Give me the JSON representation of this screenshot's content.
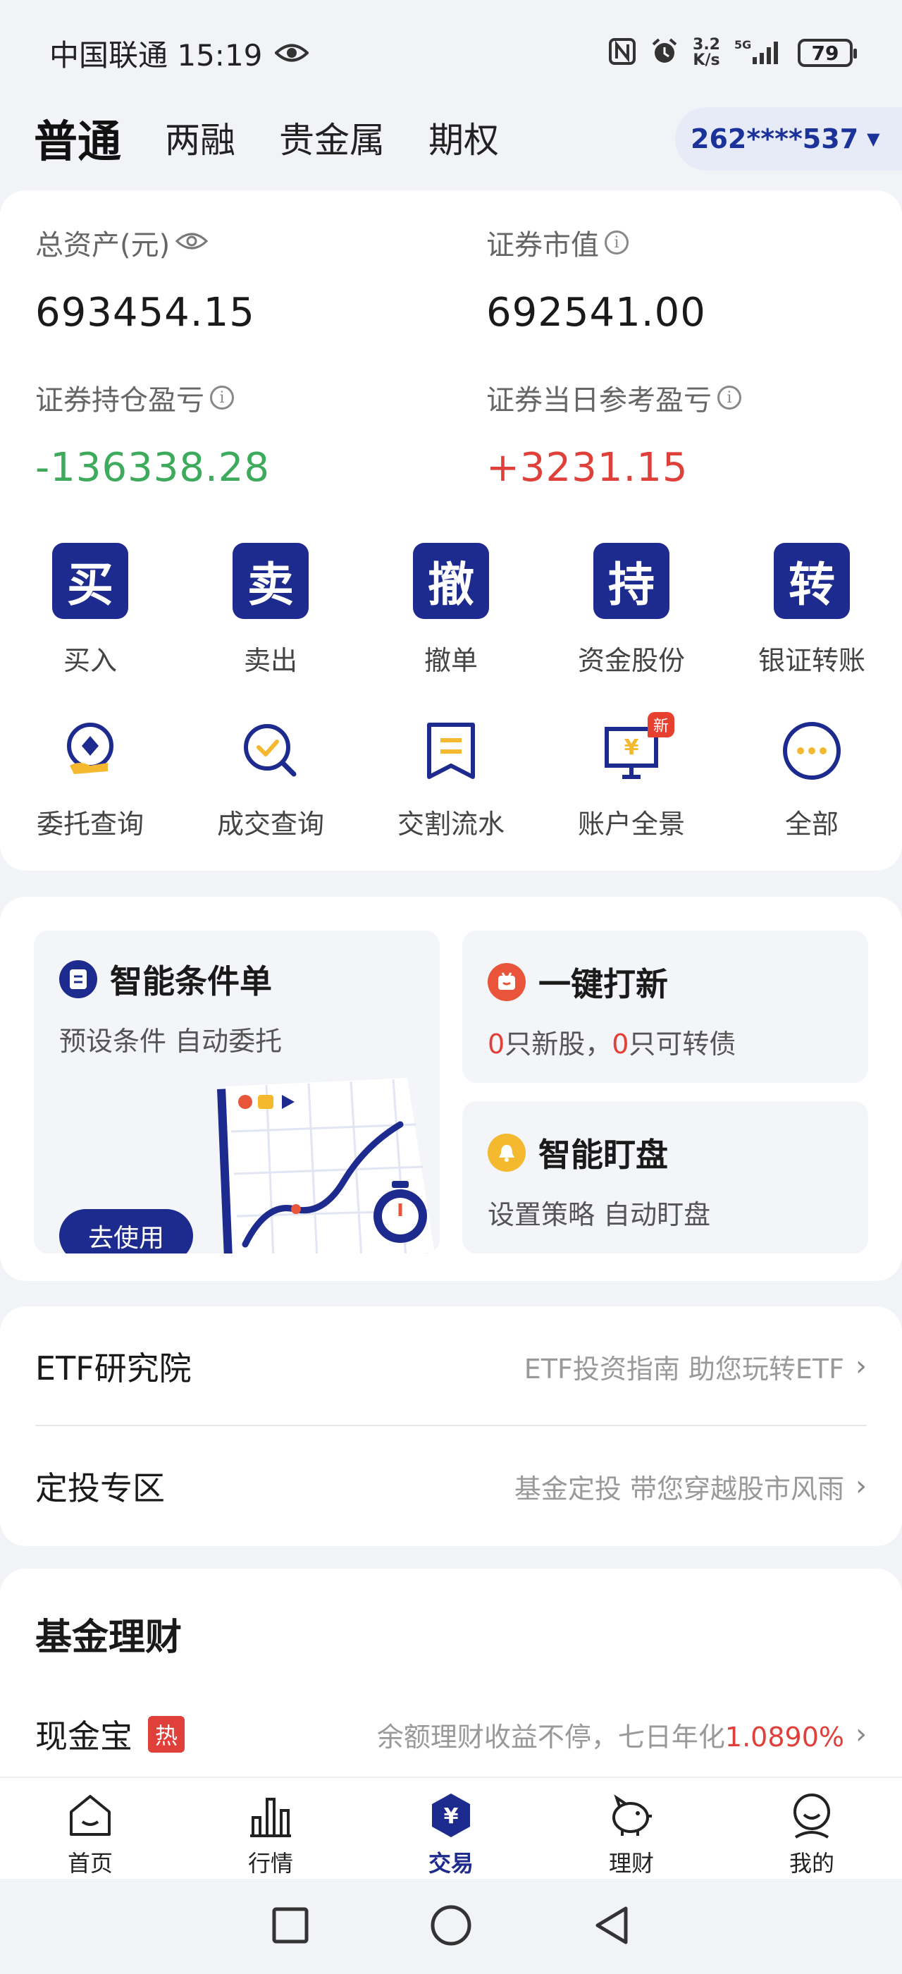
{
  "status_bar": {
    "carrier_time": "中国联通 15:19",
    "net_speed_top": "3.2",
    "net_speed_bottom": "K/s",
    "battery": "79"
  },
  "tabs": [
    {
      "label": "普通",
      "active": true
    },
    {
      "label": "两融",
      "active": false
    },
    {
      "label": "贵金属",
      "active": false
    },
    {
      "label": "期权",
      "active": false
    }
  ],
  "account": {
    "id": "262****537"
  },
  "assets": {
    "total_label": "总资产(元)",
    "total_value": "693454.15",
    "market_label": "证券市值",
    "market_value": "692541.00",
    "holding_pl_label": "证券持仓盈亏",
    "holding_pl_value": "-136338.28",
    "daily_pl_label": "证券当日参考盈亏",
    "daily_pl_value": "+3231.15"
  },
  "quick_actions": [
    {
      "glyph": "买",
      "label": "买入"
    },
    {
      "glyph": "卖",
      "label": "卖出"
    },
    {
      "glyph": "撤",
      "label": "撤单"
    },
    {
      "glyph": "持",
      "label": "资金股份"
    },
    {
      "glyph": "转",
      "label": "银证转账"
    }
  ],
  "secondary_actions": [
    {
      "label": "委托查询",
      "icon": "order-query-icon"
    },
    {
      "label": "成交查询",
      "icon": "deal-query-icon"
    },
    {
      "label": "交割流水",
      "icon": "settlement-icon"
    },
    {
      "label": "账户全景",
      "icon": "account-overview-icon",
      "badge": "新"
    },
    {
      "label": "全部",
      "icon": "more-icon"
    }
  ],
  "features": {
    "smart_order": {
      "title": "智能条件单",
      "subtitle": "预设条件 自动委托",
      "button": "去使用"
    },
    "ipo": {
      "title": "一键打新",
      "new_stock_count": "0",
      "new_stock_text": "只新股，",
      "bond_count": "0",
      "bond_text": "只可转债"
    },
    "watch": {
      "title": "智能盯盘",
      "subtitle": "设置策略 自动盯盘"
    }
  },
  "links": [
    {
      "title": "ETF研究院",
      "desc": "ETF投资指南 助您玩转ETF"
    },
    {
      "title": "定投专区",
      "desc": "基金定投 带您穿越股市风雨"
    }
  ],
  "fund": {
    "heading": "基金理财",
    "item_name": "现金宝",
    "hot_badge": "热",
    "desc_prefix": "余额理财收益不停，七日年化",
    "rate": "1.0890%"
  },
  "bottom_nav": [
    {
      "label": "首页",
      "icon": "home-icon",
      "active": false
    },
    {
      "label": "行情",
      "icon": "market-icon",
      "active": false
    },
    {
      "label": "交易",
      "icon": "trade-icon",
      "active": true
    },
    {
      "label": "理财",
      "icon": "wealth-icon",
      "active": false
    },
    {
      "label": "我的",
      "icon": "profile-icon",
      "active": false
    }
  ],
  "colors": {
    "primary": "#1D2B8F",
    "loss": "#3DAA5C",
    "gain": "#E0403A",
    "background": "#F2F3F7"
  }
}
